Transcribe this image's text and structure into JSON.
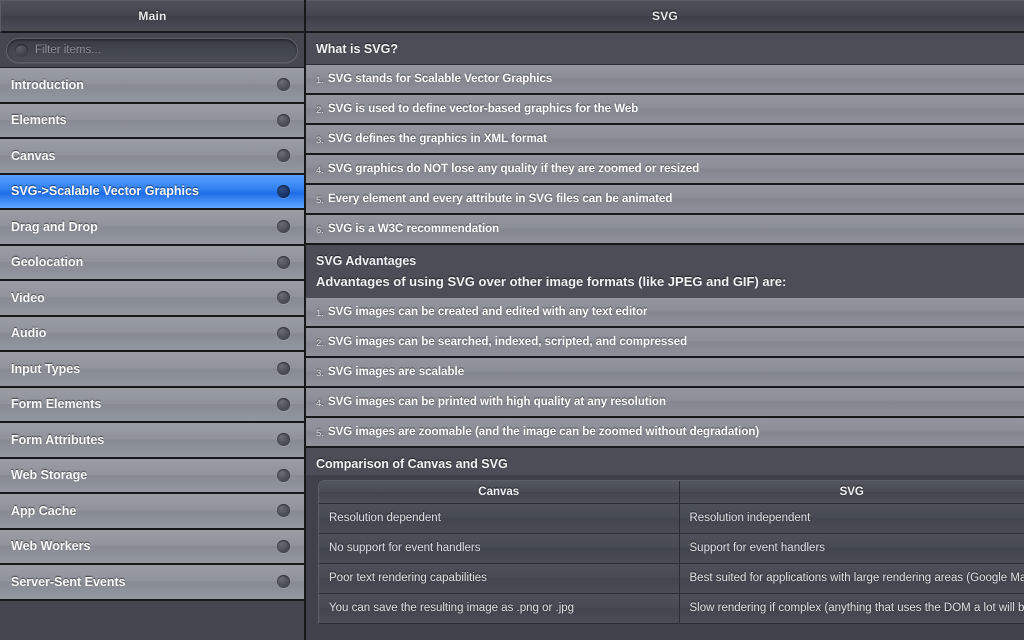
{
  "sidebar": {
    "header_title": "Main",
    "filter": {
      "placeholder": "Filter items...",
      "value": "",
      "icon": "circle-icon"
    },
    "items": [
      {
        "label": "Introduction",
        "selected": false
      },
      {
        "label": "Elements",
        "selected": false
      },
      {
        "label": "Canvas",
        "selected": false
      },
      {
        "label": "SVG->Scalable Vector Graphics",
        "selected": true
      },
      {
        "label": "Drag and Drop",
        "selected": false
      },
      {
        "label": "Geolocation",
        "selected": false
      },
      {
        "label": "Video",
        "selected": false
      },
      {
        "label": "Audio",
        "selected": false
      },
      {
        "label": "Input Types",
        "selected": false
      },
      {
        "label": "Form Elements",
        "selected": false
      },
      {
        "label": "Form Attributes",
        "selected": false
      },
      {
        "label": "Web Storage",
        "selected": false
      },
      {
        "label": "App Cache",
        "selected": false
      },
      {
        "label": "Web Workers",
        "selected": false
      },
      {
        "label": "Server-Sent Events",
        "selected": false
      }
    ]
  },
  "content": {
    "header_title": "SVG",
    "section1": {
      "title": "What is SVG?",
      "items": [
        {
          "num": "1.",
          "text": "SVG stands for Scalable Vector Graphics"
        },
        {
          "num": "2.",
          "text": "SVG is used to define vector-based graphics for the Web"
        },
        {
          "num": "3.",
          "text": "SVG defines the graphics in XML format"
        },
        {
          "num": "4.",
          "text": "SVG graphics do NOT lose any quality if they are zoomed or resized"
        },
        {
          "num": "5.",
          "text": "Every element and every attribute in SVG files can be animated"
        },
        {
          "num": "6.",
          "text": "SVG is a W3C recommendation"
        }
      ]
    },
    "section2": {
      "title": "SVG Advantages",
      "subtitle": "Advantages of using SVG over other image formats (like JPEG and GIF) are:",
      "items": [
        {
          "num": "1.",
          "text": "SVG images can be created and edited with any text editor"
        },
        {
          "num": "2.",
          "text": "SVG images can be searched, indexed, scripted, and compressed"
        },
        {
          "num": "3.",
          "text": "SVG images are scalable"
        },
        {
          "num": "4.",
          "text": "SVG images can be printed with high quality at any resolution"
        },
        {
          "num": "5.",
          "text": "SVG images are zoomable (and the image can be zoomed without degradation)"
        }
      ]
    },
    "section3": {
      "title": "Comparison of Canvas and SVG",
      "table": {
        "columns": [
          "Canvas",
          "SVG"
        ],
        "rows": [
          [
            "Resolution dependent",
            "Resolution independent"
          ],
          [
            "No support for event handlers",
            "Support for event handlers"
          ],
          [
            "Poor text rendering capabilities",
            "Best suited for applications with large rendering areas (Google Maps)"
          ],
          [
            "You can save the resulting image as .png or .jpg",
            "Slow rendering if complex (anything that uses the DOM a lot will be slow)"
          ]
        ]
      }
    }
  },
  "colors": {
    "selection_blue": "#2f7ff2",
    "panel_dark": "#44474f",
    "row_gray": "#8f9199",
    "border_dark": "#16181c"
  }
}
